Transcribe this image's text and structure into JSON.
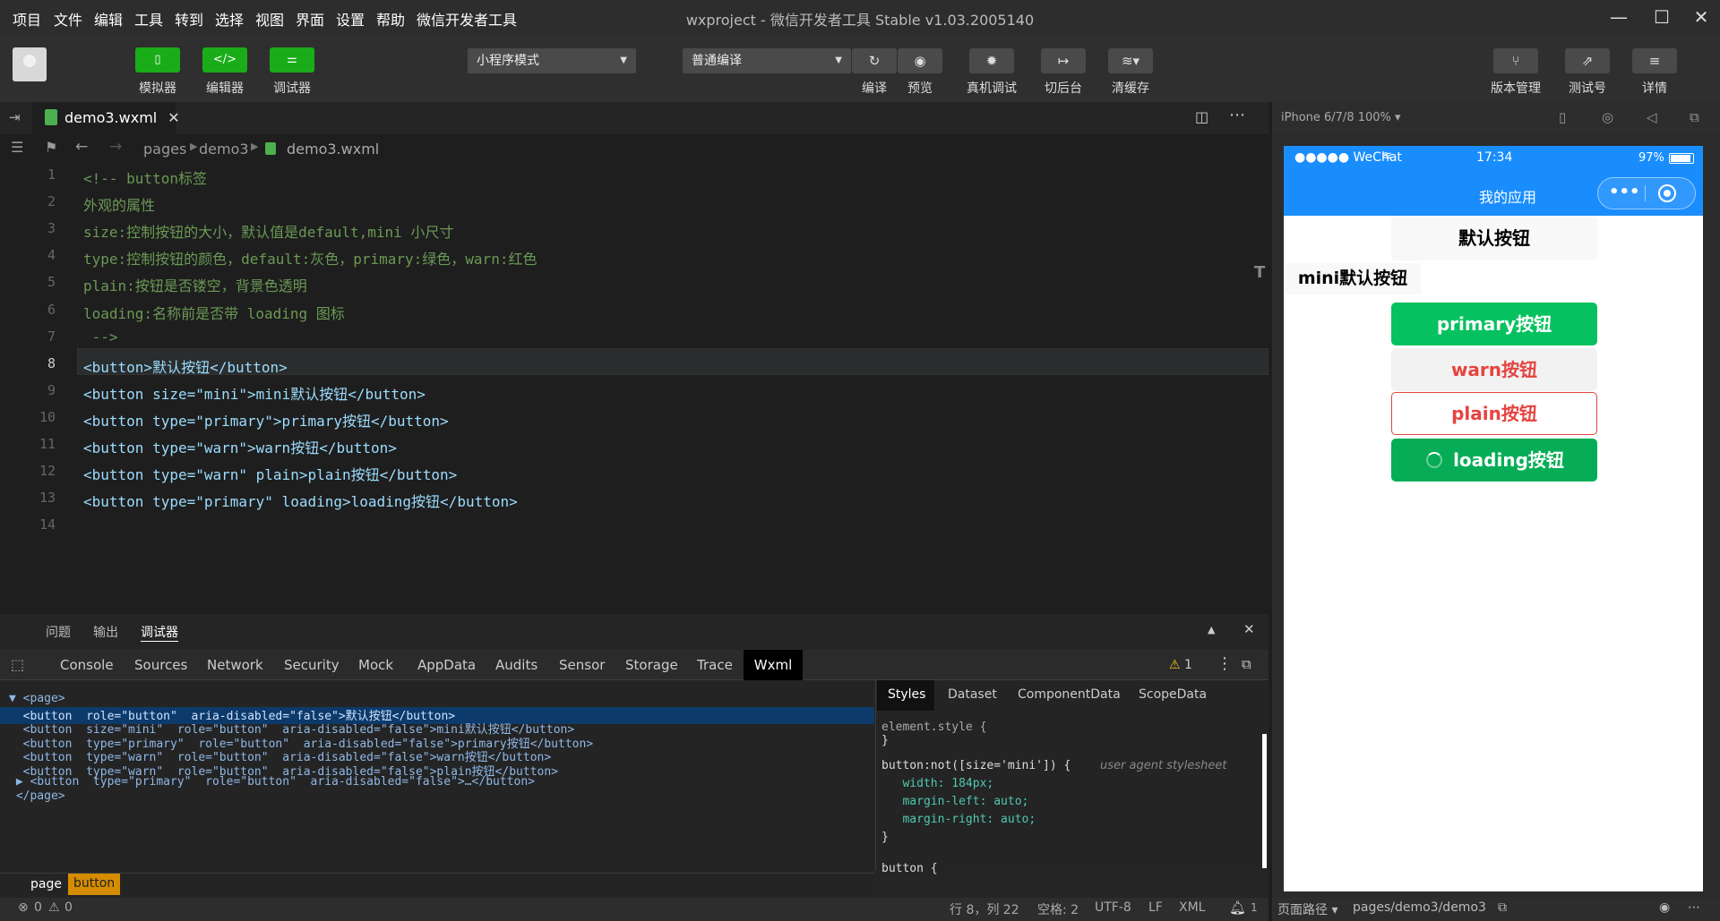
{
  "menubar": {
    "items": [
      "项目",
      "文件",
      "编辑",
      "工具",
      "转到",
      "选择",
      "视图",
      "界面",
      "设置",
      "帮助",
      "微信开发者工具"
    ],
    "title": "wxproject - 微信开发者工具 Stable v1.03.2005140"
  },
  "toolbar": {
    "simulator": "模拟器",
    "editor": "编辑器",
    "debugger": "调试器",
    "mode_select": "小程序模式",
    "compile_select": "普通编译",
    "compile": "编译",
    "preview": "预览",
    "remote_debug": "真机调试",
    "background": "切后台",
    "clear_cache": "清缓存",
    "version": "版本管理",
    "test_account": "测试号",
    "details": "详情"
  },
  "editor": {
    "tab": "demo3.wxml",
    "breadcrumb": [
      "pages",
      "demo3",
      "demo3.wxml"
    ],
    "line_numbers": [
      "1",
      "2",
      "3",
      "4",
      "5",
      "6",
      "7",
      "8",
      "9",
      "10",
      "11",
      "12",
      "13",
      "14"
    ],
    "lines": [
      "<!-- button标签",
      "外观的属性",
      "size:控制按钮的大小，默认值是default,mini 小尺寸",
      "type:控制按钮的颜色，default:灰色，primary:绿色，warn:红色",
      "plain:按钮是否镂空，背景色透明",
      "loading:名称前是否带 loading 图标",
      " -->",
      "<button>默认按钮</button>",
      "<button size=\"mini\">mini默认按钮</button>",
      "<button type=\"primary\">primary按钮</button>",
      "<button type=\"warn\">warn按钮</button>",
      "<button type=\"warn\" plain>plain按钮</button>",
      "<button type=\"primary\" loading>loading按钮</button>",
      ""
    ]
  },
  "panel": {
    "tabs": [
      "问题",
      "输出",
      "调试器"
    ],
    "devtools_tabs": [
      "Console",
      "Sources",
      "Network",
      "Security",
      "Mock",
      "AppData",
      "Audits",
      "Sensor",
      "Storage",
      "Trace",
      "Wxml"
    ],
    "warning_count": "1",
    "dom_lines": [
      "▼ <page>",
      "  <button  role=\"button\"  aria-disabled=\"false\">默认按钮</button>",
      "  <button  size=\"mini\"  role=\"button\"  aria-disabled=\"false\">mini默认按钮</button>",
      "  <button  type=\"primary\"  role=\"button\"  aria-disabled=\"false\">primary按钮</button>",
      "  <button  type=\"warn\"  role=\"button\"  aria-disabled=\"false\">warn按钮</button>",
      "  <button  type=\"warn\"  role=\"button\"  aria-disabled=\"false\">plain按钮</button>",
      " ▶ <button  type=\"primary\"  role=\"button\"  aria-disabled=\"false\">…</button>",
      " </page>"
    ],
    "style_tabs": [
      "Styles",
      "Dataset",
      "ComponentData",
      "ScopeData"
    ],
    "style_lines": [
      "element.style {",
      "}",
      "button:not([size='mini']) {",
      "   width: 184px;",
      "   margin-left: auto;",
      "   margin-right: auto;",
      "}",
      "button {"
    ],
    "user_agent": "user agent stylesheet",
    "crumbs": [
      "page",
      "button"
    ]
  },
  "statusbar": {
    "errors": "0",
    "warnings": "0",
    "position": "行 8，列 22",
    "spaces": "空格: 2",
    "encoding": "UTF-8",
    "eol": "LF",
    "lang": "XML",
    "notifications": "1"
  },
  "simulator": {
    "device": "iPhone 6/7/8 100% ▾",
    "carrier": "●●●●● WeChat",
    "time": "17:34",
    "battery": "97%",
    "nav_title": "我的应用",
    "buttons": {
      "default": "默认按钮",
      "mini": "mini默认按钮",
      "primary": "primary按钮",
      "warn": "warn按钮",
      "plain": "plain按钮",
      "loading": "loading按钮"
    },
    "page_path_label": "页面路径 ▾",
    "page_path": "pages/demo3/demo3"
  }
}
